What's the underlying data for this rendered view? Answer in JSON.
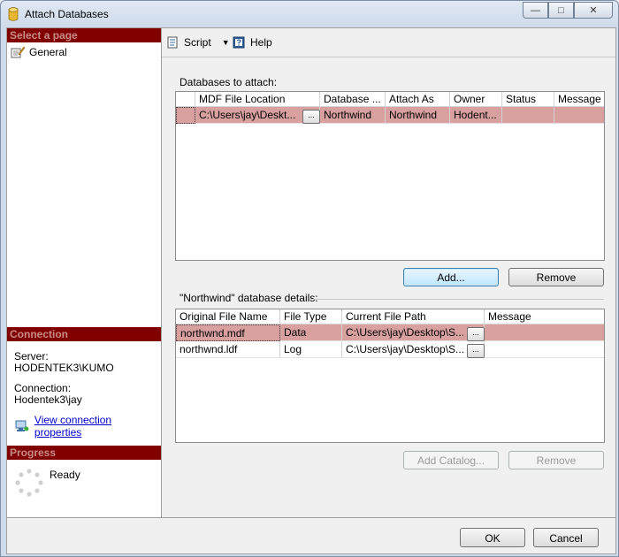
{
  "window": {
    "title": "Attach Databases"
  },
  "left_panel": {
    "select_page_header": "Select a page",
    "pages": [
      "General"
    ],
    "connection_header": "Connection",
    "server_label": "Server:",
    "server_value": "HODENTEK3\\KUMO",
    "connection_label": "Connection:",
    "connection_value": "Hodentek3\\jay",
    "view_connection_link": "View connection properties",
    "progress_header": "Progress",
    "progress_status": "Ready"
  },
  "toolbar": {
    "script_label": "Script",
    "help_label": "Help"
  },
  "attach": {
    "section_label": "Databases to attach:",
    "columns": [
      "MDF File Location",
      "Database ...",
      "Attach As",
      "Owner",
      "Status",
      "Message"
    ],
    "rows": [
      {
        "mdf": "C:\\Users\\jay\\Deskt...",
        "database": "Northwind",
        "attach_as": "Northwind",
        "owner": "Hodent...",
        "status": "",
        "message": ""
      }
    ],
    "ellipsis": "...",
    "add_button": "Add...",
    "remove_button": "Remove"
  },
  "details": {
    "section_label": "\"Northwind\" database details:",
    "columns": [
      "Original File Name",
      "File Type",
      "Current File Path",
      "Message"
    ],
    "rows": [
      {
        "name": "northwnd.mdf",
        "type": "Data",
        "path": "C:\\Users\\jay\\Desktop\\S...",
        "message": ""
      },
      {
        "name": "northwnd.ldf",
        "type": "Log",
        "path": "C:\\Users\\jay\\Desktop\\S...",
        "message": ""
      }
    ],
    "ellipsis": "...",
    "add_catalog_button": "Add Catalog...",
    "remove_button": "Remove"
  },
  "footer": {
    "ok_button": "OK",
    "cancel_button": "Cancel"
  },
  "colors": {
    "section_header_bg": "#800000",
    "selected_row": "#d9a0a0",
    "link": "#0000cc"
  }
}
